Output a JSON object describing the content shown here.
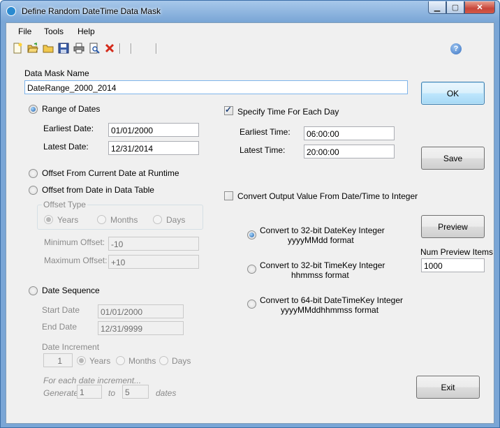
{
  "window": {
    "title": "Define Random DateTime Data Mask"
  },
  "menu": {
    "file": "File",
    "tools": "Tools",
    "help": "Help"
  },
  "toolbar": {
    "icons": [
      "new-file-icon",
      "open-folder-icon",
      "folder-icon",
      "save-icon",
      "print-icon",
      "print-preview-icon",
      "delete-icon"
    ]
  },
  "mask_name": {
    "label": "Data Mask Name",
    "value": "DateRange_2000_2014"
  },
  "buttons": {
    "ok": "OK",
    "save": "Save",
    "preview": "Preview",
    "exit": "Exit"
  },
  "range": {
    "label": "Range of Dates",
    "earliest_label": "Earliest Date:",
    "earliest_value": "01/01/2000",
    "latest_label": "Latest Date:",
    "latest_value": "12/31/2014"
  },
  "offset_runtime": {
    "label": "Offset From Current Date at Runtime"
  },
  "offset_table": {
    "label": "Offset from Date in Data Table",
    "offset_type_title": "Offset Type",
    "years": "Years",
    "months": "Months",
    "days": "Days",
    "min_label": "Minimum Offset:",
    "min_value": "-10",
    "max_label": "Maximum Offset:",
    "max_value": "+10"
  },
  "sequence": {
    "label": "Date Sequence",
    "start_label": "Start Date",
    "start_value": "01/01/2000",
    "end_label": "End Date",
    "end_value": "12/31/9999",
    "increment_label": "Date Increment",
    "increment_value": "1",
    "years": "Years",
    "months": "Months",
    "days": "Days",
    "note": "For each date increment...",
    "generate": "Generate",
    "gen_from": "1",
    "to": "to",
    "gen_to": "5",
    "dates": "dates"
  },
  "time": {
    "label": "Specify Time For Each Day",
    "earliest_label": "Earliest Time:",
    "earliest_value": "06:00:00",
    "latest_label": "Latest Time:",
    "latest_value": "20:00:00"
  },
  "convert": {
    "label": "Convert Output Value From Date/Time to Integer",
    "opt1_line1": "Convert  to 32-bit DateKey Integer",
    "opt1_line2": "yyyyMMdd format",
    "opt2_line1": "Convert to 32-bit TimeKey Integer",
    "opt2_line2": "hhmmss format",
    "opt3_line1": "Convert to 64-bit DateTimeKey Integer",
    "opt3_line2": "yyyyMMddhhmmss format"
  },
  "preview": {
    "num_label": "Num Preview Items",
    "num_value": "1000"
  }
}
